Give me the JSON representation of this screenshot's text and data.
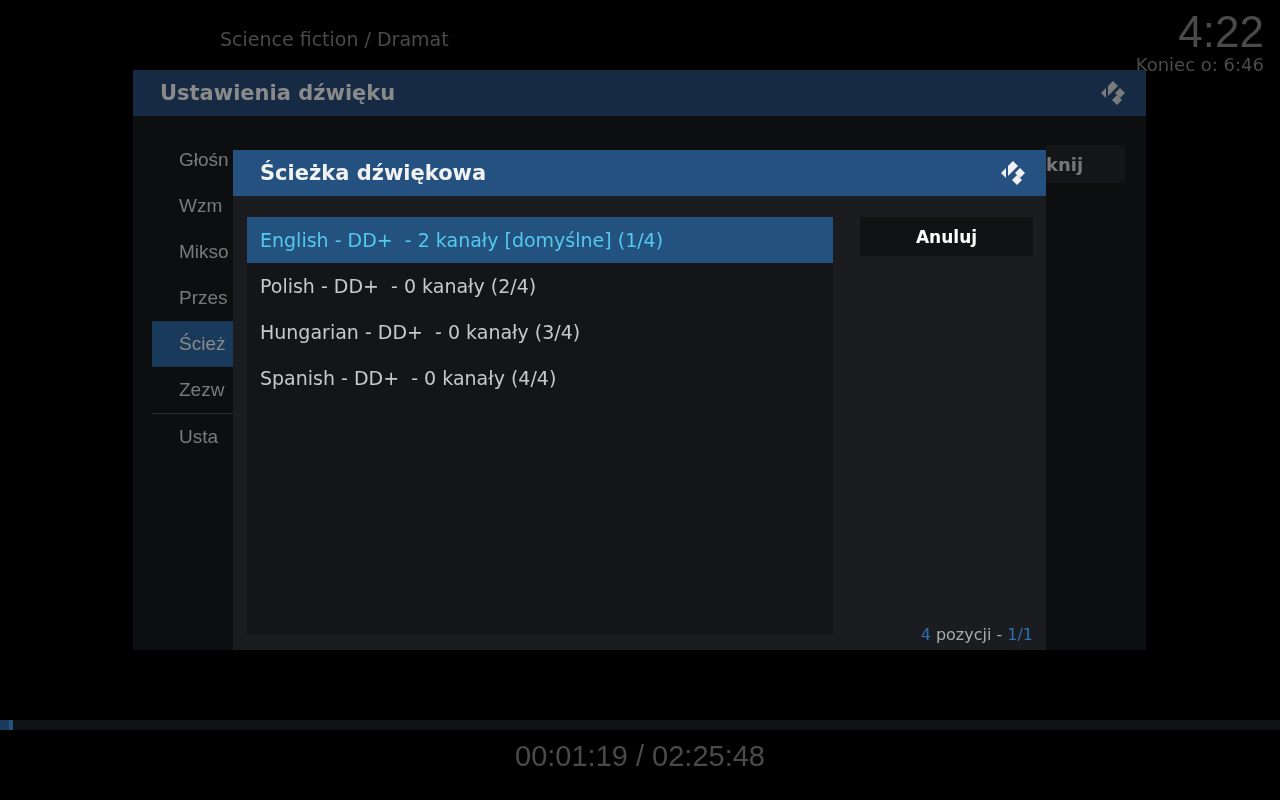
{
  "top_bar": {
    "genre": "Science fiction / Dramat",
    "clock": "4:22",
    "end_time": "Koniec o: 6:46"
  },
  "background_dialog": {
    "title": "Ustawienia dźwięku",
    "button": "knij",
    "items": [
      {
        "label": "Głośn",
        "selected": false
      },
      {
        "label": "Wzm",
        "selected": false
      },
      {
        "label": "Mikso",
        "selected": false
      },
      {
        "label": "Przes",
        "selected": false
      },
      {
        "label": "Ścież",
        "selected": true
      },
      {
        "label": "Zezw",
        "selected": false
      },
      {
        "label": "Usta",
        "selected": false
      }
    ]
  },
  "dialog": {
    "title": "Ścieżka dźwiękowa",
    "items": [
      {
        "label": "English - DD+  - 2 kanały [domyślne] (1/4)",
        "selected": true
      },
      {
        "label": "Polish - DD+  - 0 kanały (2/4)",
        "selected": false
      },
      {
        "label": "Hungarian - DD+  - 0 kanały (3/4)",
        "selected": false
      },
      {
        "label": "Spanish - DD+  - 0 kanały (4/4)",
        "selected": false
      }
    ],
    "cancel_button": "Anuluj",
    "footer": {
      "count": "4",
      "label": "pozycji -",
      "page": "1/1"
    }
  },
  "player": {
    "progress": {
      "level": 0.01
    },
    "time": "00:01:19 / 02:25:48"
  }
}
